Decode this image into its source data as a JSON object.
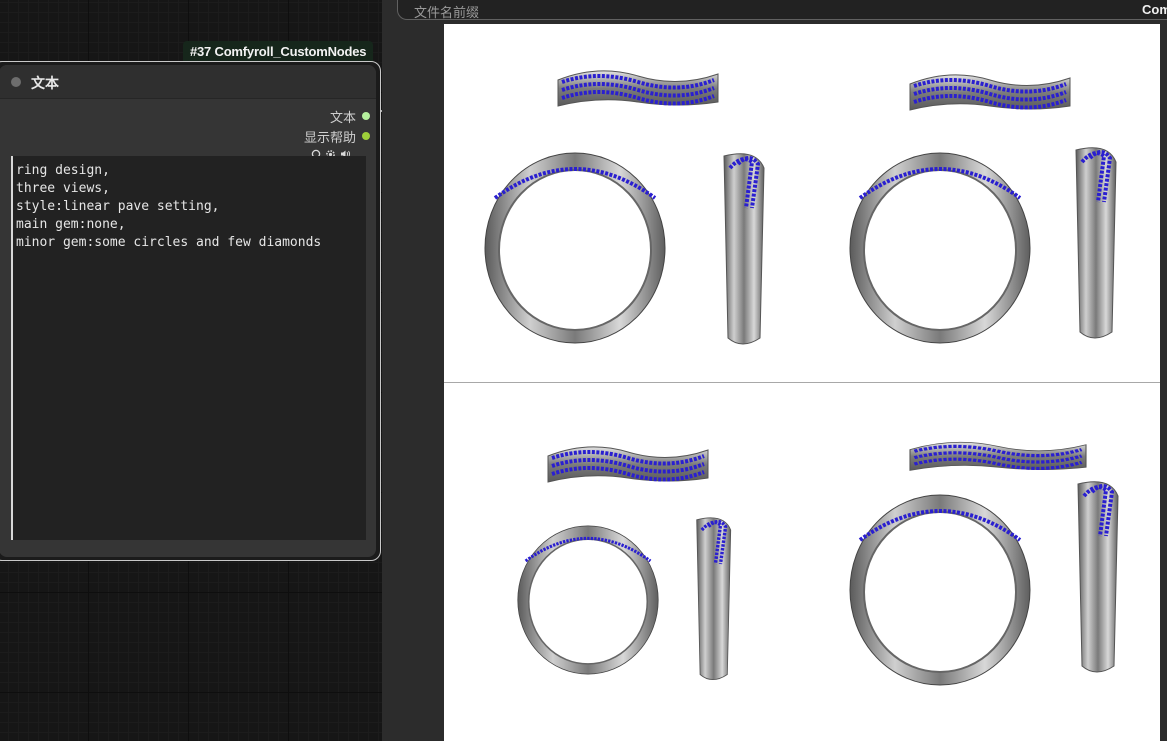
{
  "node": {
    "badge": "#37 Comfyroll_CustomNodes",
    "title": "文本",
    "outputs": [
      {
        "label": "文本",
        "color": "#b5f09d"
      },
      {
        "label": "显示帮助",
        "color": "#9ecf3a"
      }
    ],
    "widget_icons": [
      "circle-icon",
      "gear-icon",
      "speaker-icon"
    ],
    "text": "ring design,\nthree views,\nstyle:linear pave setting,\nmain gem:none,\nminor gem:some circles and few diamonds"
  },
  "panel": {
    "prefix_label": "文件名前缀",
    "right_truncated": "Com"
  },
  "preview": {
    "grid": "2x2",
    "subject": "ring three-view renders",
    "metal_color": "#8a8a8a",
    "gem_color": "#2a1fd0"
  }
}
